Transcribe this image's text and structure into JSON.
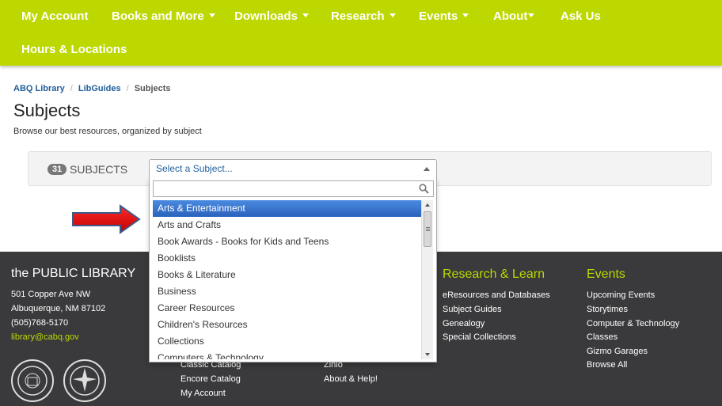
{
  "nav": {
    "row1": [
      {
        "label": "My Account",
        "dropdown": false
      },
      {
        "label": "Books and More",
        "dropdown": true
      },
      {
        "label": "Downloads",
        "dropdown": true
      },
      {
        "label": "Research",
        "dropdown": true
      },
      {
        "label": "Events",
        "dropdown": true
      },
      {
        "label": "About",
        "dropdown": true
      },
      {
        "label": "Ask Us",
        "dropdown": false
      }
    ],
    "row2": [
      {
        "label": "Hours & Locations",
        "dropdown": false
      }
    ]
  },
  "breadcrumb": {
    "items": [
      "ABQ Library",
      "LibGuides"
    ],
    "separator": "/",
    "current": "Subjects"
  },
  "page": {
    "title": "Subjects",
    "subtitle": "Browse our best resources, organized by subject"
  },
  "subjects": {
    "count": "31",
    "label": "SUBJECTS",
    "select_placeholder": "Select a Subject...",
    "options": [
      "Arts & Entertainment",
      "Arts and Crafts",
      "Book Awards - Books for Kids and Teens",
      "Booklists",
      "Books & Literature",
      "Business",
      "Career Resources",
      "Children's Resources",
      "Collections",
      "Computers & Technology"
    ],
    "highlighted_index": 0
  },
  "footer": {
    "brand": "the PUBLIC LIBRARY",
    "address": [
      "501 Copper Ave NW",
      "Albuquerque, NM 87102",
      "(505)768-5170"
    ],
    "email": "library@cabq.gov",
    "col2_links": [
      "Classic Catalog",
      "Encore Catalog",
      "My Account"
    ],
    "col3_links": [
      "Zinio",
      "About & Help!"
    ],
    "research": {
      "heading": "Research & Learn",
      "links": [
        "eResources and Databases",
        "Subject Guides",
        "Genealogy",
        "Special Collections"
      ]
    },
    "events": {
      "heading": "Events",
      "links": [
        "Upcoming Events",
        "Storytimes",
        "Computer & Technology",
        "Classes",
        "Gizmo Garages",
        "Browse All"
      ]
    }
  },
  "colors": {
    "nav_bg": "#bcd800",
    "link": "#1f5e9b",
    "footer_bg": "#3a3a3c",
    "highlight": "#3875d7",
    "arrow": "#e3000f"
  }
}
